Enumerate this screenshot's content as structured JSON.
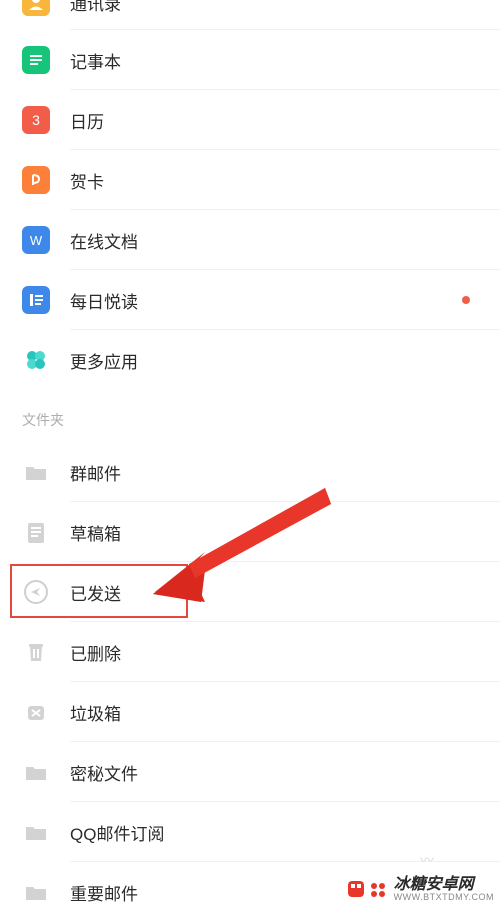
{
  "apps": [
    {
      "name": "contacts",
      "label": "通讯录",
      "color": "#f8b63d"
    },
    {
      "name": "notepad",
      "label": "记事本",
      "color": "#16c47a"
    },
    {
      "name": "calendar",
      "label": "日历",
      "color": "#f25d4a",
      "badge": "3"
    },
    {
      "name": "cards",
      "label": "贺卡",
      "color": "#fc7f3a"
    },
    {
      "name": "docs",
      "label": "在线文档",
      "color": "#3d88e8"
    },
    {
      "name": "daily-read",
      "label": "每日悦读",
      "color": "#3d88e8",
      "dot": true
    },
    {
      "name": "more-apps",
      "label": "更多应用",
      "color": "#28c5bd"
    }
  ],
  "folders_header": "文件夹",
  "folders": [
    {
      "name": "group-mail",
      "label": "群邮件"
    },
    {
      "name": "drafts",
      "label": "草稿箱"
    },
    {
      "name": "sent",
      "label": "已发送",
      "highlighted": true
    },
    {
      "name": "deleted",
      "label": "已删除"
    },
    {
      "name": "junk",
      "label": "垃圾箱"
    },
    {
      "name": "secret",
      "label": "密秘文件"
    },
    {
      "name": "qq-subscribe",
      "label": "QQ邮件订阅"
    },
    {
      "name": "important",
      "label": "重要邮件"
    }
  ],
  "watermark": {
    "text": "冰糖安卓网",
    "url": "WWW.BTXTDMY.COM"
  }
}
